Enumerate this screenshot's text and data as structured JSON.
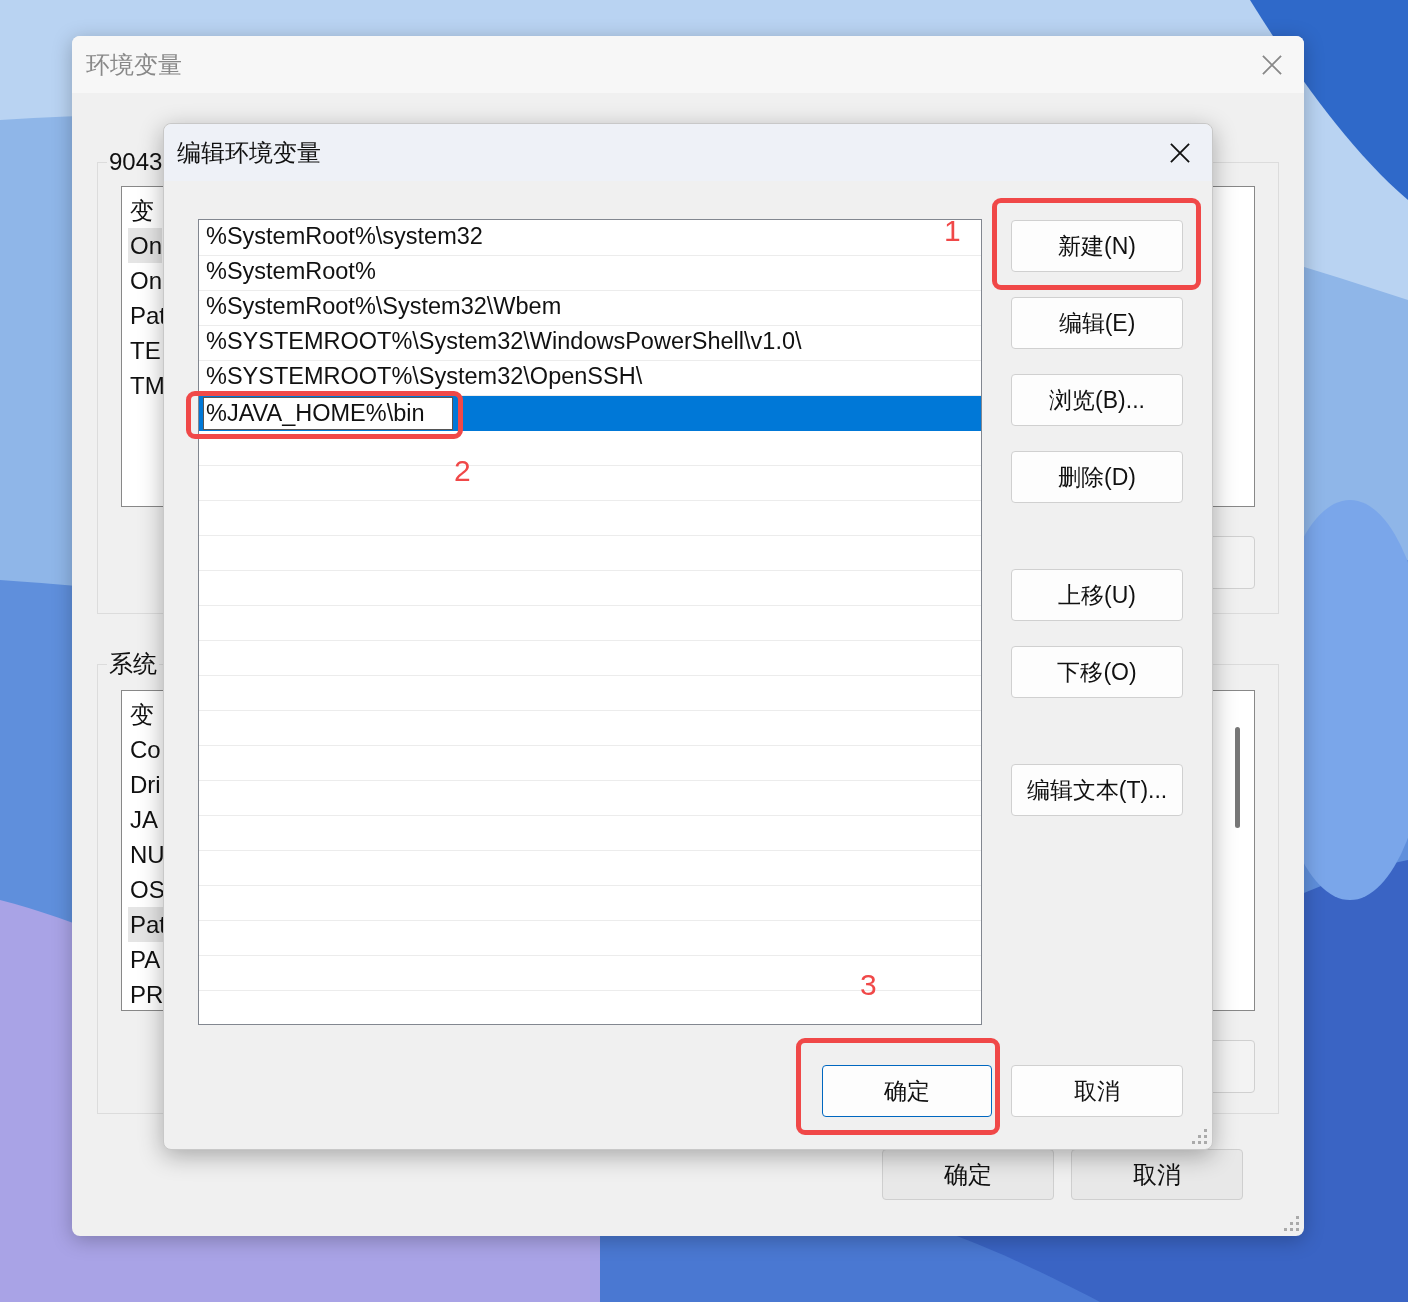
{
  "background_window": {
    "title": "环境变量",
    "user_group_label": "9043",
    "user_list": {
      "header": "变",
      "rows": [
        {
          "text": "On",
          "selected": true
        },
        {
          "text": "On",
          "selected": false
        },
        {
          "text": "Pat",
          "selected": false
        },
        {
          "text": "TE",
          "selected": false
        },
        {
          "text": "TM",
          "selected": false
        }
      ]
    },
    "system_group_label": "系统",
    "system_list": {
      "header": "变",
      "rows": [
        {
          "text": "Co",
          "selected": false
        },
        {
          "text": "Dri",
          "selected": false
        },
        {
          "text": "JA",
          "selected": false
        },
        {
          "text": "NU",
          "selected": false
        },
        {
          "text": "OS",
          "selected": false
        },
        {
          "text": "Pat",
          "selected": true
        },
        {
          "text": "PA",
          "selected": false
        },
        {
          "text": "PR",
          "selected": false
        }
      ]
    },
    "buttons": [
      "确定",
      "取消"
    ]
  },
  "edit_dialog": {
    "title": "编辑环境变量",
    "entries": [
      {
        "text": "%SystemRoot%\\system32",
        "selected": false,
        "editing": false
      },
      {
        "text": "%SystemRoot%",
        "selected": false,
        "editing": false
      },
      {
        "text": "%SystemRoot%\\System32\\Wbem",
        "selected": false,
        "editing": false
      },
      {
        "text": "%SYSTEMROOT%\\System32\\WindowsPowerShell\\v1.0\\",
        "selected": false,
        "editing": false
      },
      {
        "text": "%SYSTEMROOT%\\System32\\OpenSSH\\",
        "selected": false,
        "editing": false
      },
      {
        "text": "%JAVA_HOME%\\bin",
        "selected": true,
        "editing": true
      }
    ],
    "buttons": [
      "新建(N)",
      "编辑(E)",
      "浏览(B)...",
      "删除(D)",
      "上移(U)",
      "下移(O)",
      "编辑文本(T)..."
    ],
    "footer_buttons": [
      {
        "label": "确定",
        "default": true
      },
      {
        "label": "取消",
        "default": false
      }
    ]
  },
  "annotations": [
    {
      "label": "1"
    },
    {
      "label": "2"
    },
    {
      "label": "3"
    }
  ]
}
